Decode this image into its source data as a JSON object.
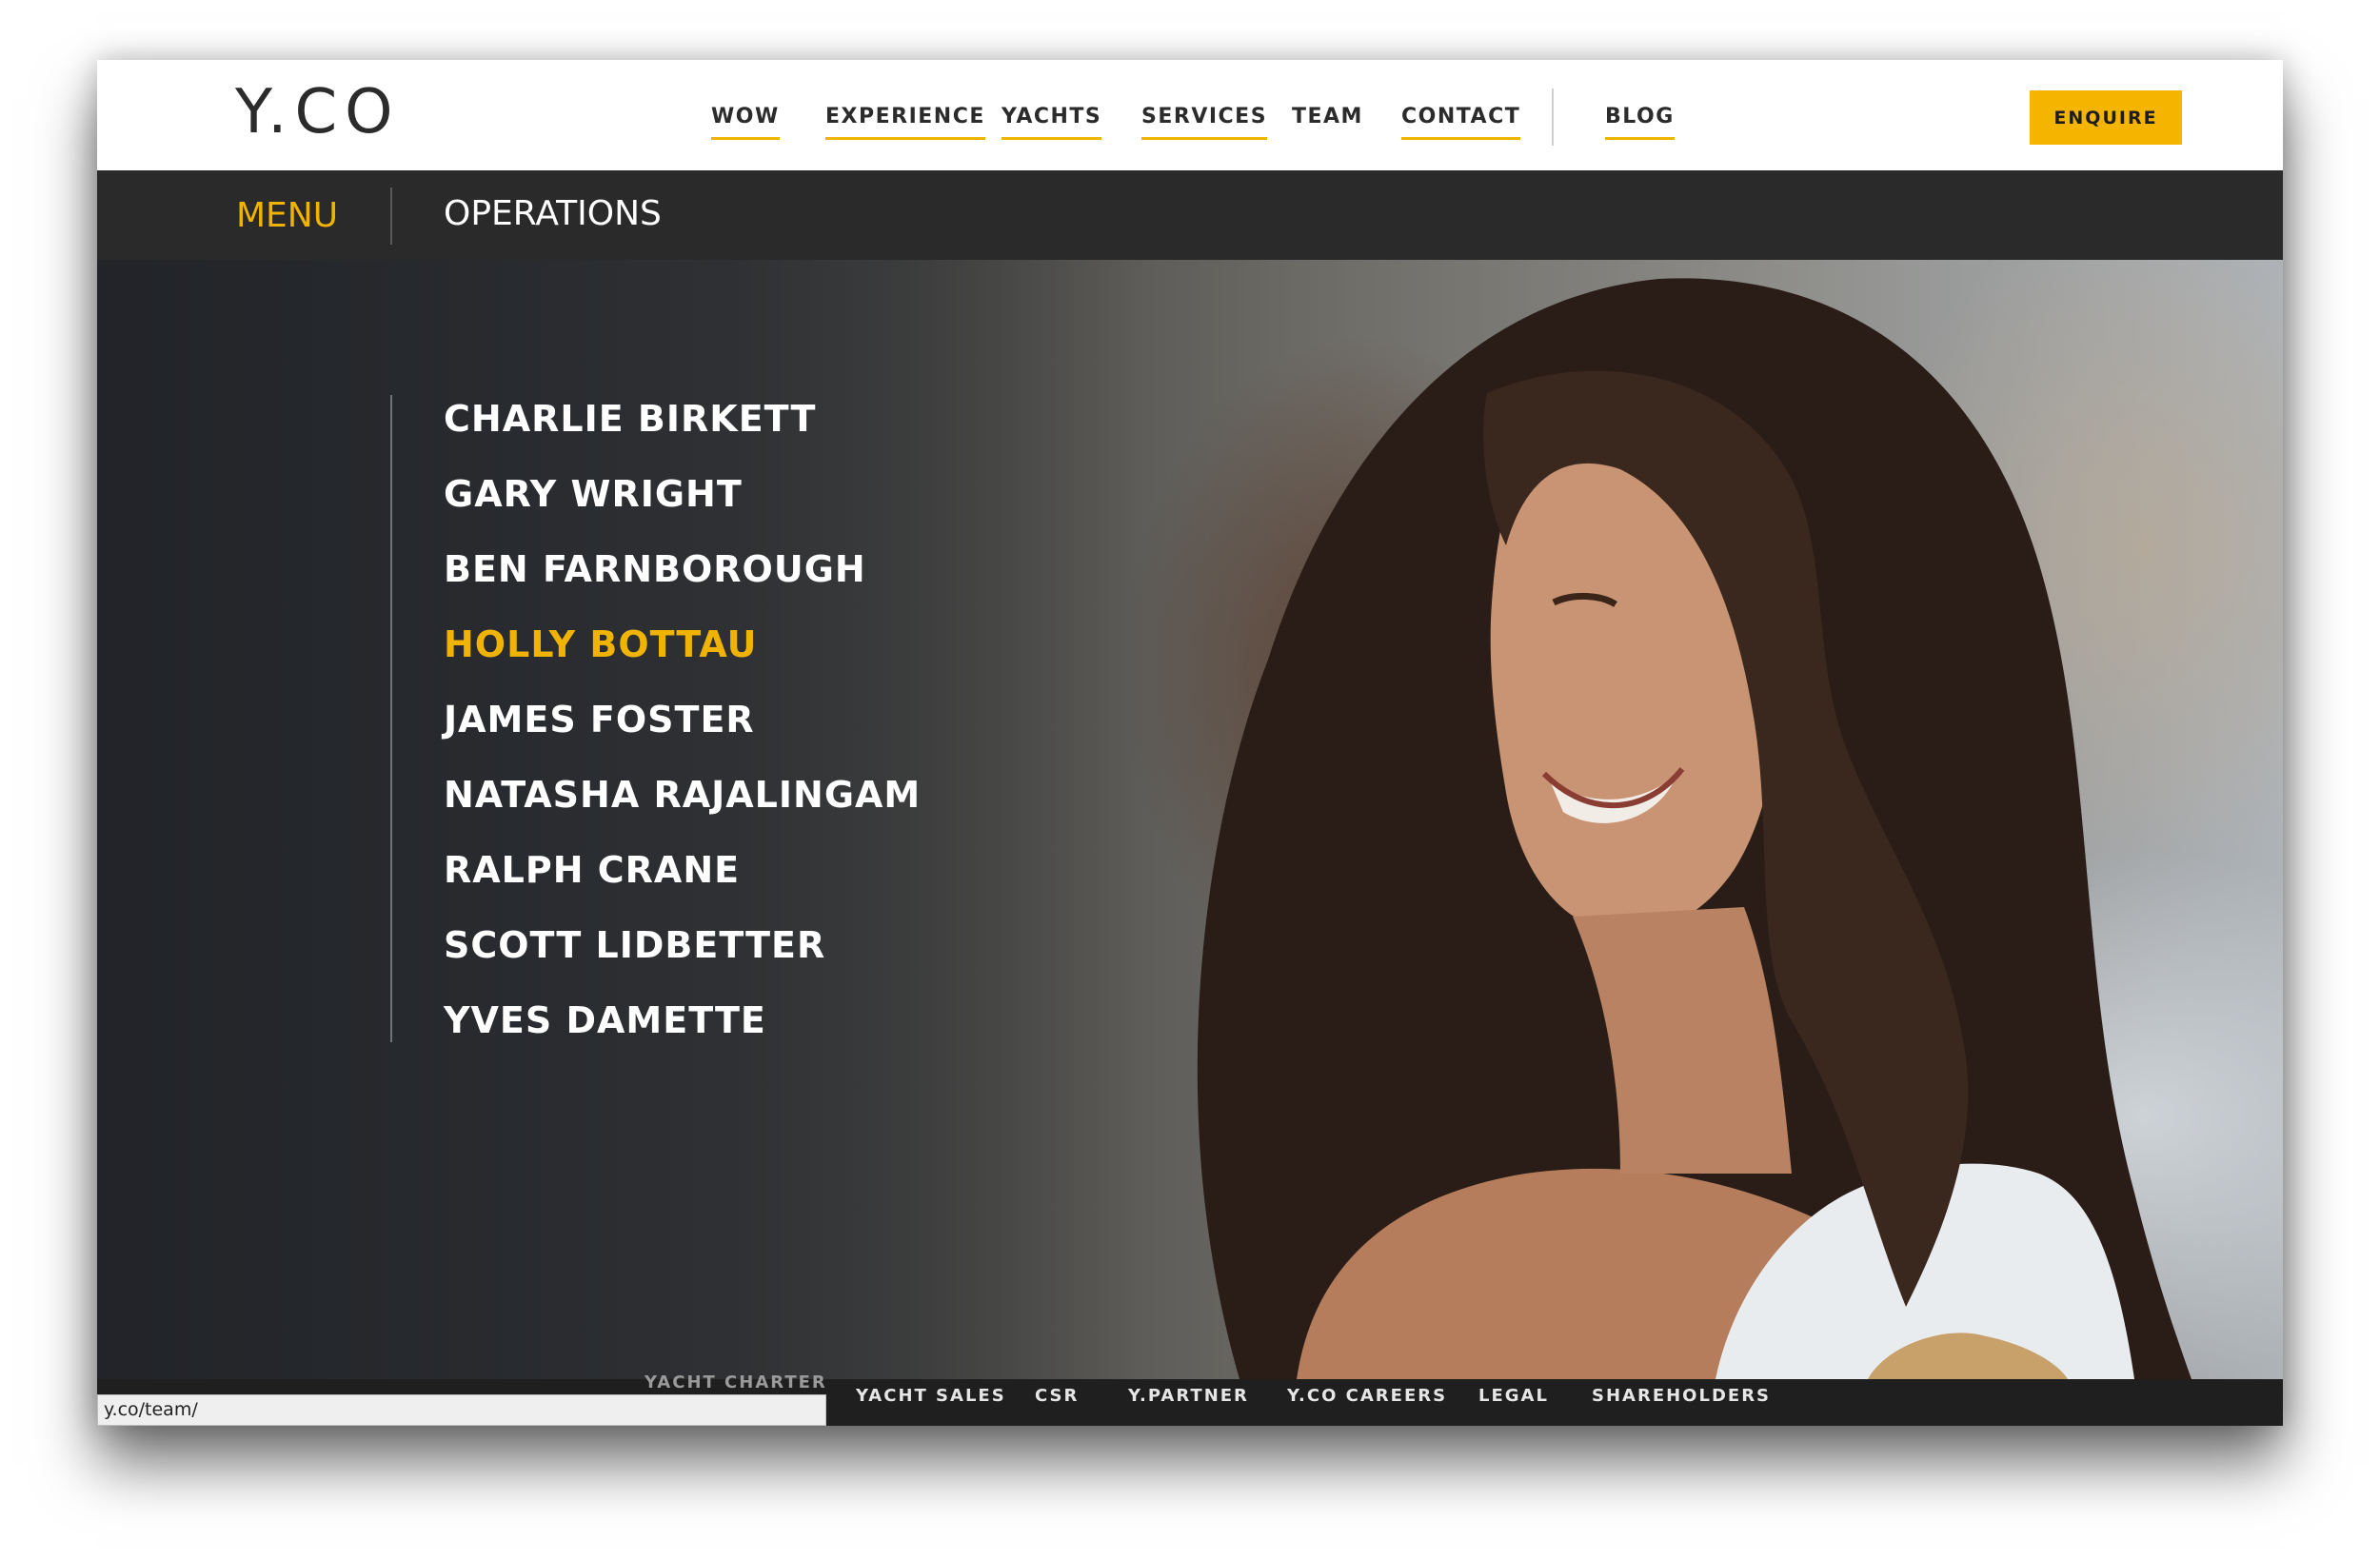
{
  "brand": {
    "logo_text": "Y.CO"
  },
  "nav": {
    "items": [
      {
        "label": "WOW",
        "underlined": true
      },
      {
        "label": "EXPERIENCE",
        "underlined": true
      },
      {
        "label": "YACHTS",
        "underlined": true
      },
      {
        "label": "SERVICES",
        "underlined": true
      },
      {
        "label": "TEAM",
        "underlined": false
      },
      {
        "label": "CONTACT",
        "underlined": true
      },
      {
        "label": "BLOG",
        "underlined": true
      }
    ],
    "cta_label": "ENQUIRE"
  },
  "subbar": {
    "menu_label": "MENU",
    "section_label": "OPERATIONS"
  },
  "team": {
    "members": [
      "CHARLIE BIRKETT",
      "GARY WRIGHT",
      "BEN FARNBOROUGH",
      "HOLLY BOTTAU",
      "JAMES FOSTER",
      "NATASHA RAJALINGAM",
      "RALPH CRANE",
      "SCOTT LIDBETTER",
      "YVES DAMETTE"
    ],
    "active": "HOLLY BOTTAU"
  },
  "footer": {
    "items": [
      "YACHT CHARTER",
      "YACHT SALES",
      "CSR",
      "Y.PARTNER",
      "Y.CO CAREERS",
      "LEGAL",
      "SHAREHOLDERS"
    ]
  },
  "status_bar": {
    "url": "y.co/team/"
  },
  "colors": {
    "accent": "#f0b400",
    "dark_bar": "#2a2a2a",
    "footer_bar": "#1f1f1f",
    "text_dark": "#2b2b2b"
  }
}
